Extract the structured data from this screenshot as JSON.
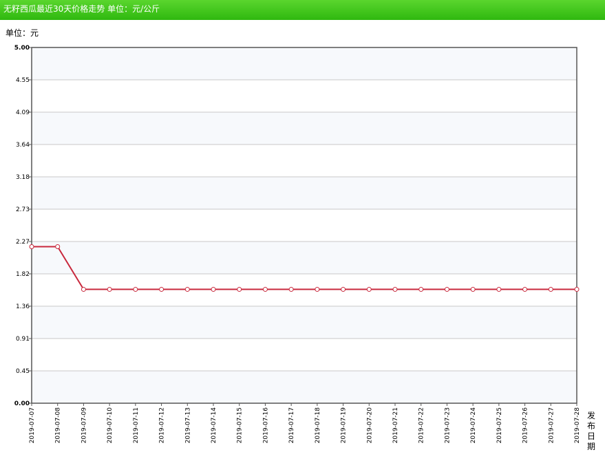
{
  "header": {
    "title": "无籽西瓜最近30天价格走势 单位：元/公斤"
  },
  "unit_label": "单位：元",
  "chart_data": {
    "type": "line",
    "title": "无籽西瓜最近30天价格走势 单位：元/公斤",
    "xlabel": "发布日期",
    "ylabel": "单位：元",
    "ylim": [
      0,
      5.0
    ],
    "yticks": [
      "0.00",
      "0.45",
      "0.91",
      "1.36",
      "1.82",
      "2.27",
      "2.73",
      "3.18",
      "3.64",
      "4.09",
      "4.55",
      "5.00"
    ],
    "categories": [
      "2019-07-07",
      "2019-07-08",
      "2019-07-09",
      "2019-07-10",
      "2019-07-11",
      "2019-07-12",
      "2019-07-13",
      "2019-07-14",
      "2019-07-15",
      "2019-07-16",
      "2019-07-17",
      "2019-07-18",
      "2019-07-19",
      "2019-07-20",
      "2019-07-21",
      "2019-07-22",
      "2019-07-23",
      "2019-07-24",
      "2019-07-25",
      "2019-07-26",
      "2019-07-27",
      "2019-07-28"
    ],
    "series": [
      {
        "values": [
          2.2,
          2.2,
          1.6,
          1.6,
          1.6,
          1.6,
          1.6,
          1.6,
          1.6,
          1.6,
          1.6,
          1.6,
          1.6,
          1.6,
          1.6,
          1.6,
          1.6,
          1.6,
          1.6,
          1.6,
          1.6,
          1.6
        ]
      }
    ],
    "grid": true,
    "colors": {
      "line": "#c8283c",
      "marker_fill": "#ffffff",
      "band": "#f7f9fc",
      "grid": "#c8c8c8"
    }
  }
}
